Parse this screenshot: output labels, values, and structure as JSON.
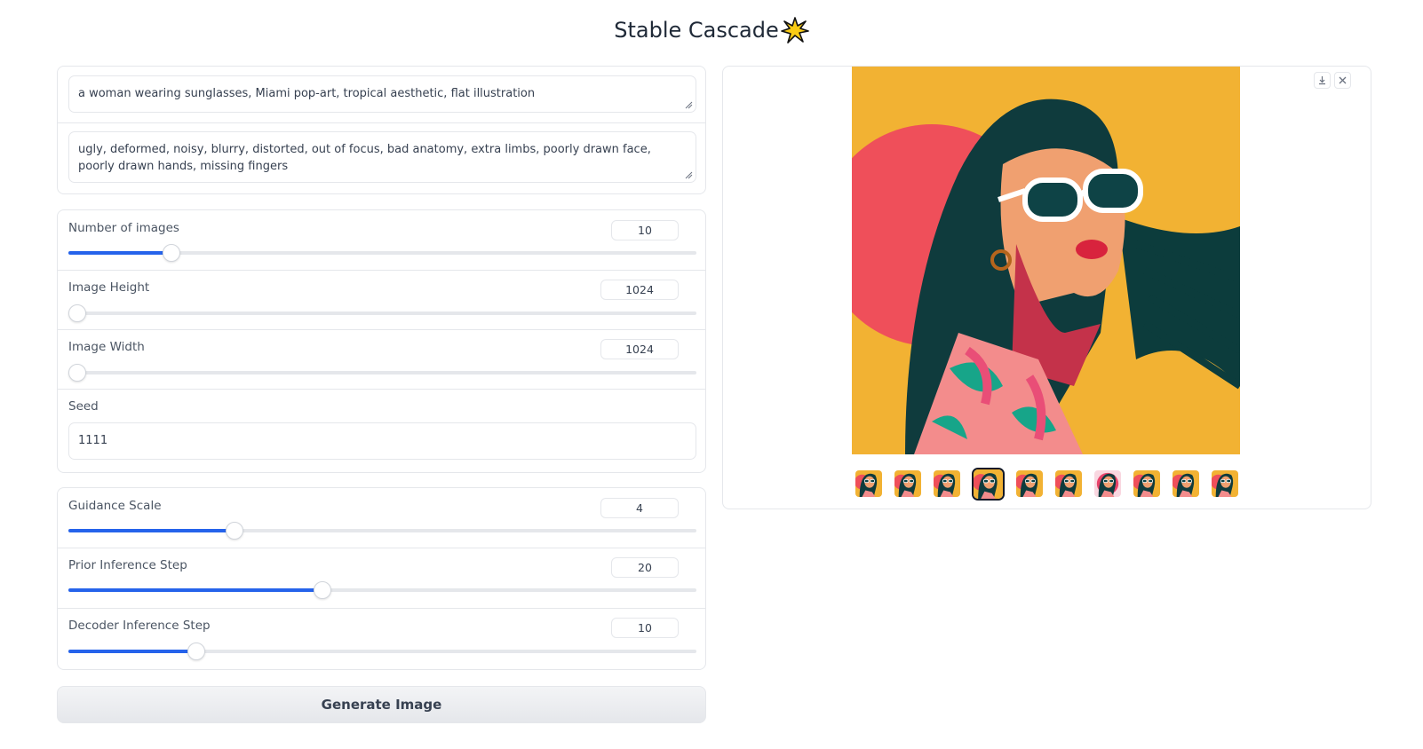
{
  "app": {
    "title": "Stable Cascade"
  },
  "prompt": {
    "value": "a woman wearing sunglasses, Miami pop-art, tropical aesthetic, flat illustration",
    "negative_value": "ugly, deformed, noisy, blurry, distorted, out of focus, bad anatomy, extra limbs, poorly drawn face, poorly drawn hands, missing fingers"
  },
  "settings": {
    "num_images": {
      "label": "Number of images",
      "value": "10",
      "fraction": 0.15
    },
    "height": {
      "label": "Image Height",
      "value": "1024",
      "fraction": 0.0
    },
    "width": {
      "label": "Image Width",
      "value": "1024",
      "fraction": 0.0
    },
    "seed": {
      "label": "Seed",
      "value": "1111"
    }
  },
  "advanced": {
    "guidance": {
      "label": "Guidance Scale",
      "value": "4",
      "fraction": 0.25
    },
    "prior_steps": {
      "label": "Prior Inference Step",
      "value": "20",
      "fraction": 0.39
    },
    "decoder_steps": {
      "label": "Decoder Inference Step",
      "value": "10",
      "fraction": 0.19
    }
  },
  "actions": {
    "generate_label": "Generate Image"
  },
  "gallery": {
    "thumbnail_count": 10,
    "selected_index": 3,
    "icons": [
      "download-icon",
      "close-icon"
    ]
  },
  "colors": {
    "accent": "#2563eb",
    "image_background": "#f2b233"
  }
}
